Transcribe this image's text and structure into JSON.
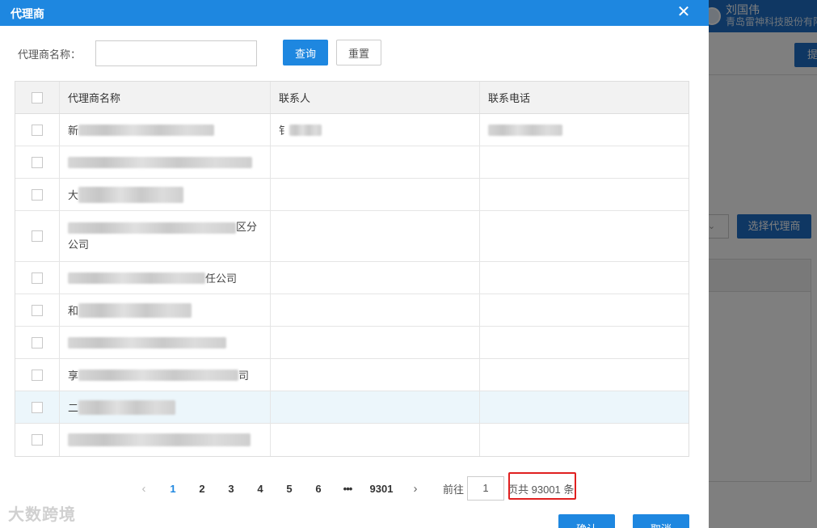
{
  "background": {
    "user_name": "刘国伟",
    "user_company": "青岛雷神科技股份有限",
    "button_ti": "提",
    "select_agent_button": "选择代理商"
  },
  "dialog": {
    "title": "代理商",
    "close_icon": "close-icon",
    "search": {
      "label": "代理商名称：",
      "value": "",
      "placeholder": "",
      "query_button": "查询",
      "reset_button": "重置"
    },
    "table": {
      "columns": [
        "代理商名称",
        "联系人",
        "联系电话"
      ],
      "rows": [
        {
          "name_prefix": "新",
          "name_suffix": "",
          "contact_prefix": "钅",
          "phone": "redacted"
        },
        {
          "name_prefix": "",
          "name_suffix": "",
          "contact_prefix": "",
          "phone": ""
        },
        {
          "name_prefix": "大",
          "name_suffix": "",
          "contact_prefix": "",
          "phone": ""
        },
        {
          "name_prefix": "",
          "name_suffix": "区分",
          "name_line2": "公司",
          "contact_prefix": "",
          "phone": ""
        },
        {
          "name_prefix": "",
          "name_suffix": "任公司",
          "contact_prefix": "",
          "phone": ""
        },
        {
          "name_prefix": "和",
          "name_suffix": "",
          "contact_prefix": "",
          "phone": ""
        },
        {
          "name_prefix": "",
          "name_suffix": "",
          "contact_prefix": "",
          "phone": ""
        },
        {
          "name_prefix": "享",
          "name_suffix": "司",
          "contact_prefix": "",
          "phone": ""
        },
        {
          "name_prefix": "二",
          "name_suffix": "",
          "contact_prefix": "",
          "phone": ""
        },
        {
          "name_prefix": "",
          "name_suffix": "",
          "contact_prefix": "",
          "phone": ""
        }
      ]
    },
    "pagination": {
      "prev": "‹",
      "pages": [
        "1",
        "2",
        "3",
        "4",
        "5",
        "6"
      ],
      "active_page": "1",
      "ellipsis": "•••",
      "last_page": "9301",
      "next": "›",
      "goto_label": "前往",
      "goto_value": "1",
      "total_text": "页共 93001 条"
    },
    "confirm_button": "确认",
    "cancel_button": "取消"
  },
  "watermark": "大数跨境"
}
